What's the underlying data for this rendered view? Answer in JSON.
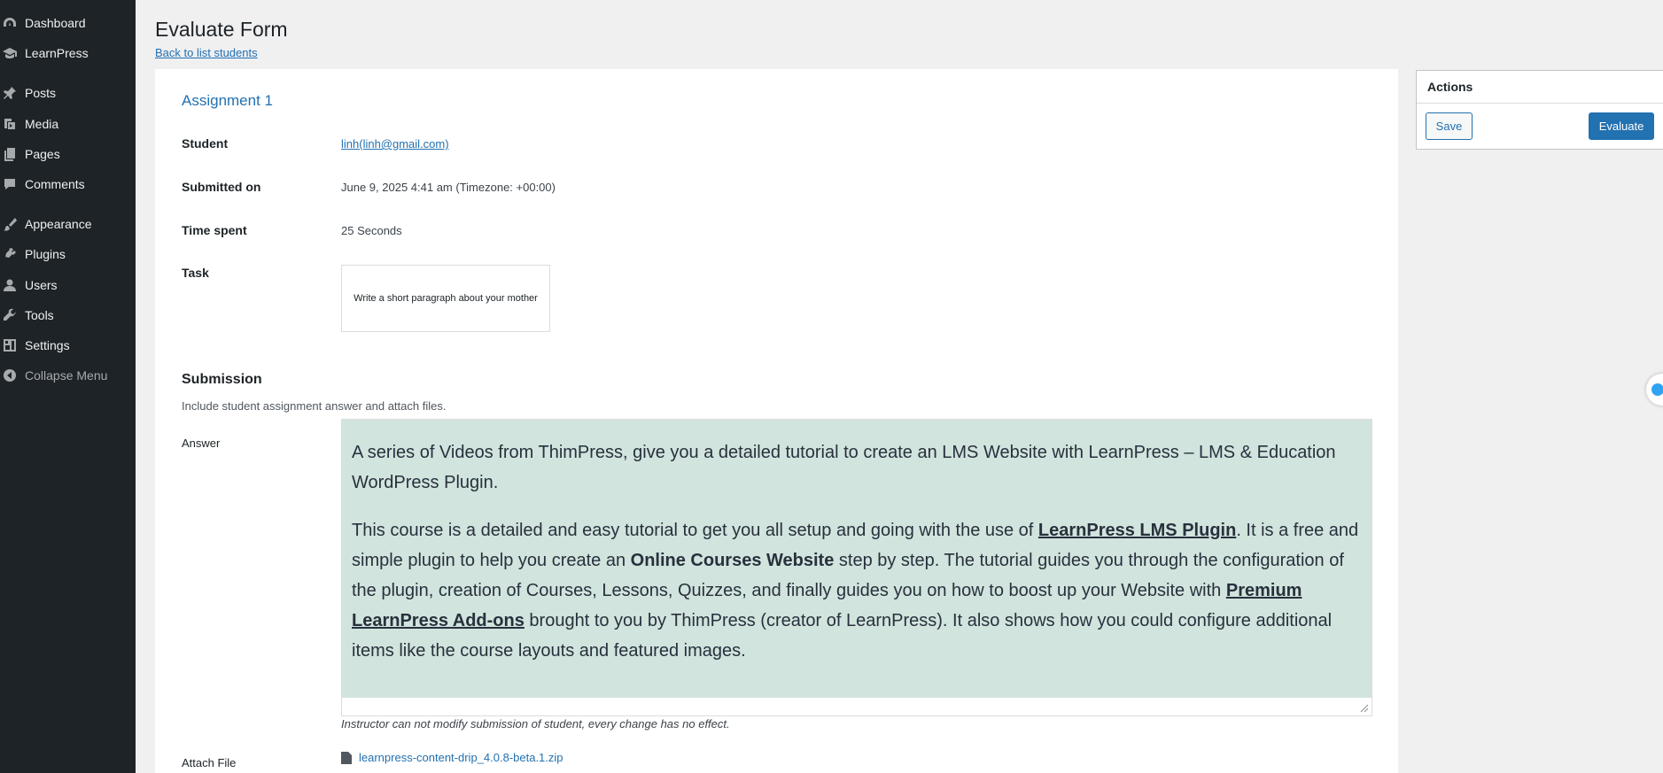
{
  "sidebar": {
    "items": [
      {
        "label": "Dashboard",
        "icon": "dashboard-icon"
      },
      {
        "label": "LearnPress",
        "icon": "learnpress-icon"
      },
      {
        "label": "Posts",
        "icon": "pin-icon"
      },
      {
        "label": "Media",
        "icon": "media-icon"
      },
      {
        "label": "Pages",
        "icon": "pages-icon"
      },
      {
        "label": "Comments",
        "icon": "comment-icon"
      },
      {
        "label": "Appearance",
        "icon": "brush-icon"
      },
      {
        "label": "Plugins",
        "icon": "plug-icon"
      },
      {
        "label": "Users",
        "icon": "user-icon"
      },
      {
        "label": "Tools",
        "icon": "wrench-icon"
      },
      {
        "label": "Settings",
        "icon": "settings-icon"
      },
      {
        "label": "Collapse Menu",
        "icon": "collapse-icon"
      }
    ]
  },
  "header": {
    "title": "Evaluate Form",
    "back_link": "Back to list students"
  },
  "form": {
    "assignment_title": "Assignment 1",
    "student_label": "Student",
    "student_value": "linh(linh@gmail.com)",
    "submitted_label": "Submitted on",
    "submitted_value": "June 9, 2025 4:41 am (Timezone: +00:00)",
    "time_label": "Time spent",
    "time_value": "25 Seconds",
    "task_label": "Task",
    "task_value": "Write a short paragraph about your mother",
    "submission_title": "Submission",
    "submission_desc": "Include student assignment answer and attach files.",
    "answer_label": "Answer",
    "answer": {
      "p1": "A series of Videos from ThimPress, give you a detailed tutorial to create an LMS Website with LearnPress – LMS & Education WordPress Plugin.",
      "p2_a": "This course is a detailed and easy tutorial to get you all setup and going with the use of ",
      "p2_link1": "LearnPress LMS Plugin",
      "p2_b": ". It is a free and simple plugin to help you create an ",
      "p2_bold": "Online Courses Website",
      "p2_c": " step by step. The tutorial guides you through the configuration of the plugin, creation of Courses, Lessons, Quizzes, and finally guides you on how to boost up your Website with ",
      "p2_link2": "Premium LearnPress Add-ons",
      "p2_d": " brought to you by ThimPress (creator of LearnPress). It also shows how you could configure additional items like the course layouts and featured images."
    },
    "note": "Instructor can not modify submission of student, every change has no effect.",
    "attach_label": "Attach File",
    "attach_file": "learnpress-content-drip_4.0.8-beta.1.zip"
  },
  "actions": {
    "title": "Actions",
    "save_label": "Save",
    "evaluate_label": "Evaluate"
  },
  "colors": {
    "sidebar_bg": "#1d2327",
    "accent": "#2271b1",
    "answer_bg": "#d1e4dd"
  }
}
